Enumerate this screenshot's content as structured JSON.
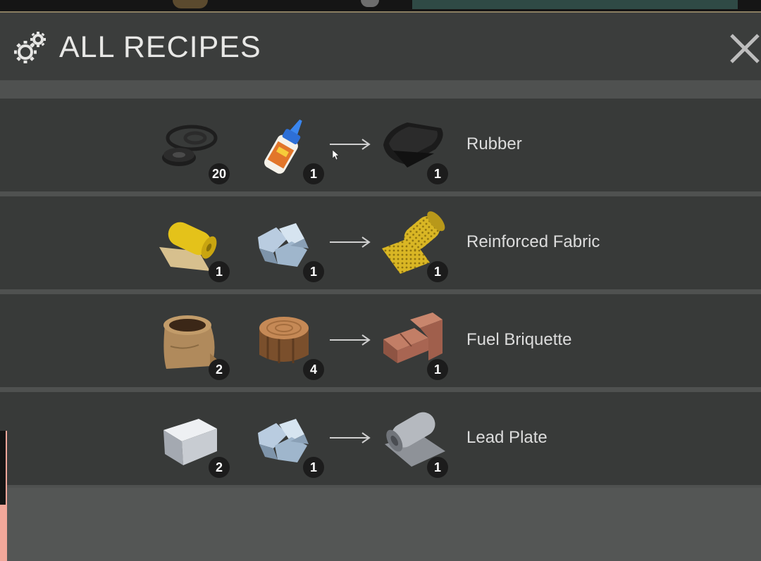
{
  "window": {
    "title": "ALL RECIPES",
    "icon": "gears-icon",
    "close_icon": "close-icon"
  },
  "recipes": [
    {
      "ingredients": [
        {
          "icon": "rubber-rings-icon",
          "count": "20"
        },
        {
          "icon": "glue-bottle-icon",
          "count": "1"
        }
      ],
      "result": {
        "icon": "rubber-sheet-icon",
        "count": "1",
        "name": "Rubber"
      }
    },
    {
      "ingredients": [
        {
          "icon": "fabric-roll-icon",
          "count": "1"
        },
        {
          "icon": "iron-ore-icon",
          "count": "1"
        }
      ],
      "result": {
        "icon": "reinforced-fabric-icon",
        "count": "1",
        "name": "Reinforced Fabric"
      }
    },
    {
      "ingredients": [
        {
          "icon": "soil-sack-icon",
          "count": "2"
        },
        {
          "icon": "log-icon",
          "count": "4"
        }
      ],
      "result": {
        "icon": "briquette-icon",
        "count": "1",
        "name": "Fuel Briquette"
      }
    },
    {
      "ingredients": [
        {
          "icon": "metal-ingot-icon",
          "count": "2"
        },
        {
          "icon": "iron-ore-icon",
          "count": "1"
        }
      ],
      "result": {
        "icon": "lead-plate-icon",
        "count": "1",
        "name": "Lead Plate"
      }
    }
  ],
  "colors": {
    "panel": "#383a39",
    "header": "#3b3d3c",
    "badge": "#1c1c1c"
  }
}
